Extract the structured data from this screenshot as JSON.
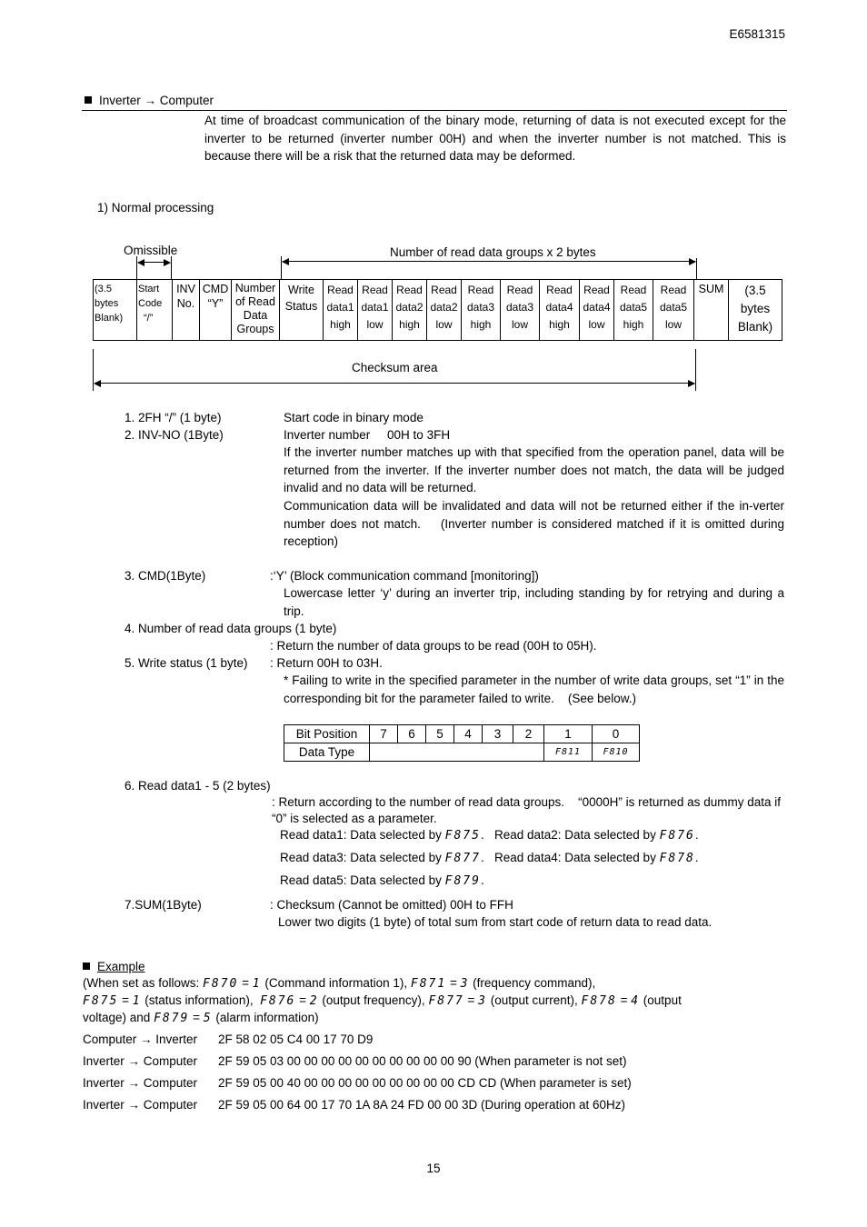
{
  "doc_id": "E6581315",
  "section": {
    "bullet_icon": "black-square",
    "title": "Inverter → Computer",
    "intro": "At time of broadcast communication of the binary mode, returning of data is not executed except for the inverter to be returned (inverter number 00H) and when the inverter number is not matched. This is because there will be a risk that the returned data may be deformed."
  },
  "subsection": "1) Normal processing",
  "diagram": {
    "omissible_label": "Omissible",
    "groups_label": "Number of read data groups x 2 bytes",
    "checksum_label": "Checksum area",
    "cells": [
      [
        "(3.5",
        "bytes",
        "Blank)"
      ],
      [
        "Start",
        "Code",
        "“/”"
      ],
      [
        "INV",
        "No."
      ],
      [
        "CMD",
        "“Y”"
      ],
      [
        "Number",
        "of Read",
        "Data",
        "Groups"
      ],
      [
        "Write",
        "Status"
      ],
      [
        "Read",
        "data1",
        "high"
      ],
      [
        "Read",
        "data1",
        "low"
      ],
      [
        "Read",
        "data2",
        "high"
      ],
      [
        "Read",
        "data2",
        "low"
      ],
      [
        "Read",
        "data3",
        "high"
      ],
      [
        "Read",
        "data3",
        "low"
      ],
      [
        "Read",
        "data4",
        "high"
      ],
      [
        "Read",
        "data4",
        "low"
      ],
      [
        "Read",
        "data5",
        "high"
      ],
      [
        "Read",
        "data5",
        "low"
      ],
      [
        "SUM"
      ],
      [
        "(3.5",
        "bytes",
        "Blank)"
      ]
    ]
  },
  "items": {
    "i1_label": "1. 2FH “/” (1 byte)",
    "i1_desc": "Start code in binary mode",
    "i2_label": "2. INV-NO (1Byte)",
    "i2_desc1": "Inverter number     00H to 3FH",
    "i2_desc2": "If the inverter number matches up with that specified from the operation panel, data will be returned from the inverter. If the inverter number does not match, the data will be judged invalid and no data will be returned.",
    "i2_desc3": "Communication data will be invalidated and data will not be returned either if the in-verter number does not match.    (Inverter number is considered matched if it is omitted during reception)",
    "i3_label": "3. CMD(1Byte)",
    "i3_desc1": ":‘Y’ (Block communication command [monitoring])",
    "i3_desc2": "Lowercase letter ‘y’ during an inverter trip, including standing by for retrying and during a trip.",
    "i4_label": "4. Number of read data groups (1 byte)",
    "i4_desc": ": Return the number of data groups to be read (00H to 05H).",
    "i5_label": "5. Write status (1 byte)",
    "i5_desc1": ": Return 00H to 03H.",
    "i5_desc2": "* Failing to write in the specified parameter in the number of write data groups, set “1” in the corresponding bit for the parameter failed to write.    (See below.)",
    "i6_label": "6. Read data1 - 5 (2 bytes)",
    "i6_desc1": ": Return according to the number of read data groups.    “0000H” is returned as dummy data if “0” is selected as a parameter.",
    "i6_rd1": "Read data1: Data selected by ",
    "i6_rd1_code": "F875",
    "i6_rd2": "Read data2: Data selected by ",
    "i6_rd2_code": "F876",
    "i6_rd3": "Read data3: Data selected by ",
    "i6_rd3_code": "F877",
    "i6_rd4": "Read data4: Data selected by ",
    "i6_rd4_code": "F878",
    "i6_rd5": "Read data5: Data selected by ",
    "i6_rd5_code": "F879",
    "i7_label": "7.SUM(1Byte)",
    "i7_desc1": ": Checksum (Cannot be omitted) 00H to FFH",
    "i7_desc2": "Lower two digits (1 byte) of total sum from start code of return data to read data."
  },
  "bit_table": {
    "row1_header": "Bit Position",
    "positions": [
      "7",
      "6",
      "5",
      "4",
      "3",
      "2",
      "1",
      "0"
    ],
    "row2_header": "Data Type",
    "types": [
      "",
      "",
      "",
      "",
      "",
      "",
      "F811",
      "F810"
    ]
  },
  "example": {
    "title": "Example",
    "line1_a": "(When set as follows: ",
    "p1": "F870",
    "v1": "1",
    "t1": " (Command information 1), ",
    "p2": "F871",
    "v2": "3",
    "t2": " (frequency command),",
    "p3": "F875",
    "v3": "1",
    "t3": " (status information),  ",
    "p4": "F876",
    "v4": "2",
    "t4": " (output frequency), ",
    "p5": "F877",
    "v5": "3",
    "t5": " (output current), ",
    "p6": "F878",
    "v6": "4",
    "t6": " (output voltage) and ",
    "p7": "F879",
    "v7": "5",
    "t7": " (alarm information)",
    "transmissions": [
      {
        "direction": "Computer → Inverter",
        "bytes": "2F 58 02 05 C4 00 17 70 D9"
      },
      {
        "direction": "Inverter → Computer",
        "bytes": "2F 59 05 03 00 00 00 00 00 00 00 00 00 00 90 (When parameter is not set)"
      },
      {
        "direction": "Inverter → Computer",
        "bytes": "2F 59 05 00 40 00 00 00 00 00 00 00 00 00 CD CD (When parameter is set)"
      },
      {
        "direction": "Inverter → Computer",
        "bytes": "2F 59 05 00 64 00 17 70 1A 8A 24 FD 00 00 3D (During operation at 60Hz)"
      }
    ]
  },
  "page_number": "15"
}
